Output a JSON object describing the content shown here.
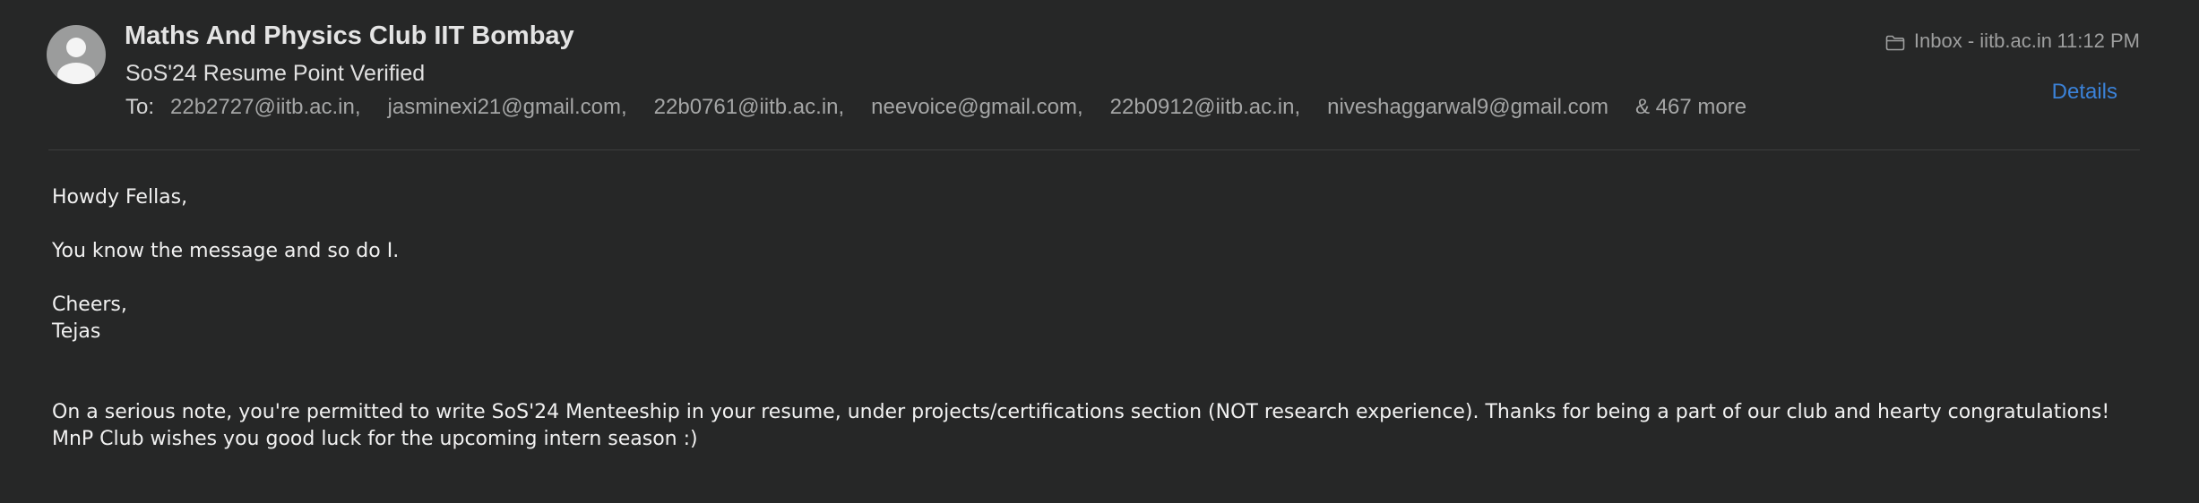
{
  "email": {
    "sender": "Maths And Physics Club IIT Bombay",
    "subject": "SoS'24 Resume Point Verified",
    "to_label": "To:",
    "recipients": [
      "22b2727@iitb.ac.in,",
      "jasminexi21@gmail.com,",
      "22b0761@iitb.ac.in,",
      "neevoice@gmail.com,",
      "22b0912@iitb.ac.in,",
      "niveshaggarwal9@gmail.com"
    ],
    "more_recipients": "& 467 more",
    "mailbox": "Inbox - iitb.ac.in",
    "time": "11:12 PM",
    "details_label": "Details",
    "icons": {
      "avatar": "person-avatar-icon",
      "mailbox": "folder-icon"
    }
  },
  "body": {
    "greeting": "Howdy Fellas,",
    "line1": "You know the message and so do I.",
    "signoff": "Cheers,",
    "signature": "Tejas",
    "paragraph": "On a serious note, you're permitted to write SoS'24 Menteeship in your resume, under projects/certifications section (NOT research experience). Thanks for being a part of our club and hearty congratulations! MnP Club wishes you good luck for the upcoming intern season :)"
  },
  "colors": {
    "background": "#262727",
    "link": "#3b82d8",
    "muted_text": "#a5a6a6"
  }
}
